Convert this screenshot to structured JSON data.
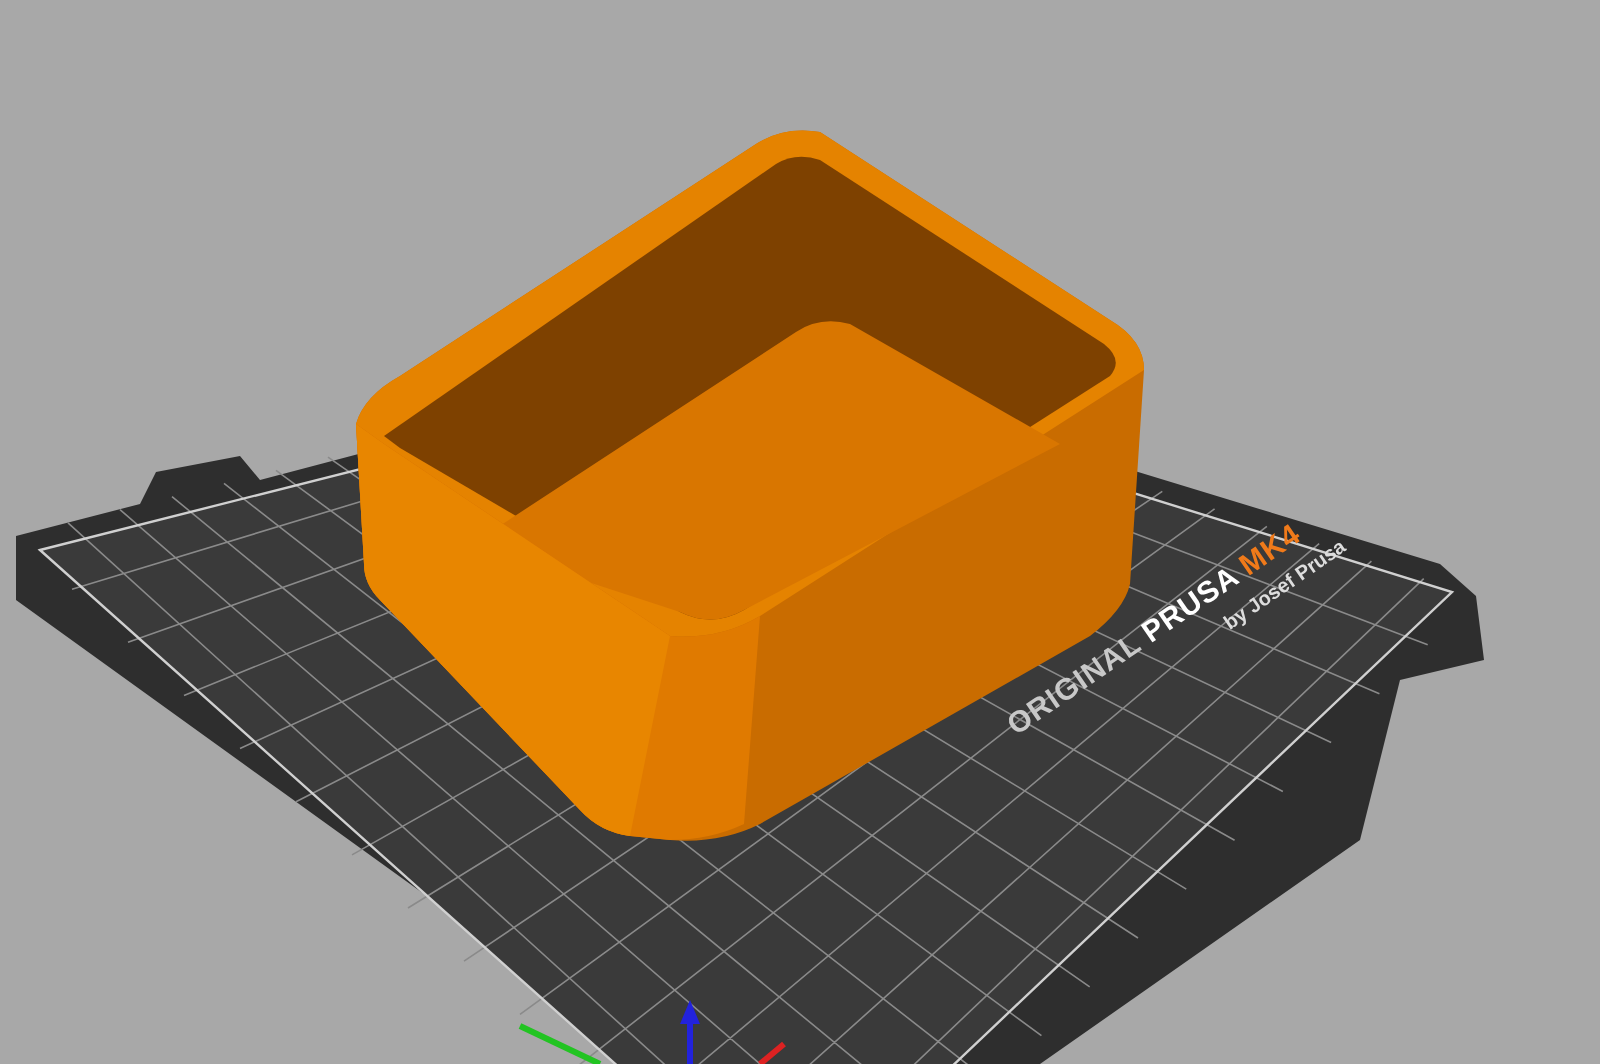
{
  "viewport": {
    "bed_label": {
      "words": [
        {
          "text": "ORIGINAL",
          "color": "#c8c8c8"
        },
        {
          "text": "PRUSA",
          "color": "#ffffff"
        },
        {
          "text": "MK4",
          "color": "#f07a1a"
        }
      ],
      "byline": "by Josef Prusa"
    }
  }
}
